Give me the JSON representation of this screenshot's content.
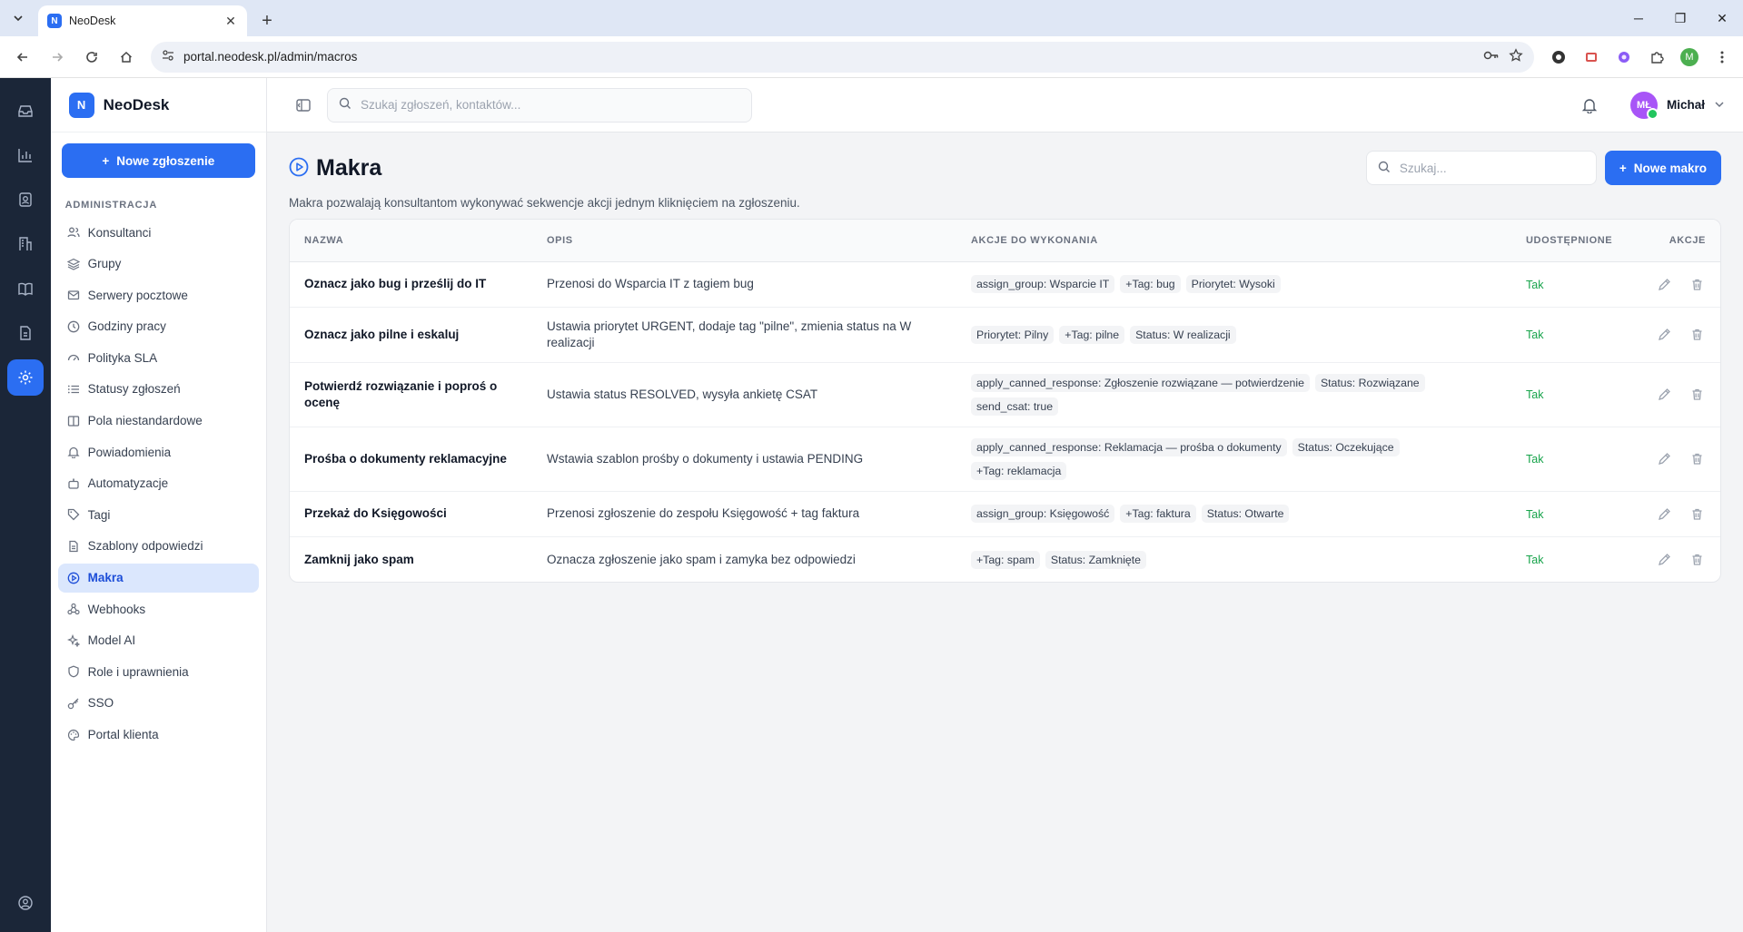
{
  "browser": {
    "tab_title": "NeoDesk",
    "favicon_letter": "N",
    "url": "portal.neodesk.pl/admin/macros",
    "profile_letter": "M"
  },
  "app": {
    "brand_letter": "N",
    "brand_name": "NeoDesk",
    "new_ticket_label": "Nowe zgłoszenie",
    "section_label": "ADMINISTRACJA",
    "nav": [
      {
        "label": "Konsultanci",
        "icon": "users-icon"
      },
      {
        "label": "Grupy",
        "icon": "layers-icon"
      },
      {
        "label": "Serwery pocztowe",
        "icon": "mail-icon"
      },
      {
        "label": "Godziny pracy",
        "icon": "clock-icon"
      },
      {
        "label": "Polityka SLA",
        "icon": "gauge-icon"
      },
      {
        "label": "Statusy zgłoszeń",
        "icon": "list-icon"
      },
      {
        "label": "Pola niestandardowe",
        "icon": "columns-icon"
      },
      {
        "label": "Powiadomienia",
        "icon": "bell-icon"
      },
      {
        "label": "Automatyzacje",
        "icon": "robot-icon"
      },
      {
        "label": "Tagi",
        "icon": "tag-icon"
      },
      {
        "label": "Szablony odpowiedzi",
        "icon": "document-icon"
      },
      {
        "label": "Makra",
        "icon": "play-circle-icon",
        "active": true
      },
      {
        "label": "Webhooks",
        "icon": "webhook-icon"
      },
      {
        "label": "Model AI",
        "icon": "sparkles-icon"
      },
      {
        "label": "Role i uprawnienia",
        "icon": "shield-icon"
      },
      {
        "label": "SSO",
        "icon": "key-icon"
      },
      {
        "label": "Portal klienta",
        "icon": "palette-icon"
      }
    ]
  },
  "topbar": {
    "search_placeholder": "Szukaj zgłoszeń, kontaktów...",
    "user_initials": "MŁ",
    "user_name": "Michał"
  },
  "page": {
    "title": "Makra",
    "description": "Makra pozwalają konsultantom wykonywać sekwencje akcji jednym kliknięciem na zgłoszeniu.",
    "search_placeholder": "Szukaj...",
    "new_button": "Nowe makro"
  },
  "table": {
    "headers": [
      "NAZWA",
      "OPIS",
      "AKCJE DO WYKONANIA",
      "UDOSTĘPNIONE",
      "AKCJE"
    ],
    "rows": [
      {
        "name": "Oznacz jako bug i prześlij do IT",
        "desc": "Przenosi do Wsparcia IT z tagiem bug",
        "actions": [
          "assign_group: Wsparcie IT",
          "+Tag: bug",
          "Priorytet: Wysoki"
        ],
        "shared": "Tak"
      },
      {
        "name": "Oznacz jako pilne i eskaluj",
        "desc": "Ustawia priorytet URGENT, dodaje tag \"pilne\", zmienia status na W realizacji",
        "actions": [
          "Priorytet: Pilny",
          "+Tag: pilne",
          "Status: W realizacji"
        ],
        "shared": "Tak"
      },
      {
        "name": "Potwierdź rozwiązanie i poproś o ocenę",
        "desc": "Ustawia status RESOLVED, wysyła ankietę CSAT",
        "actions": [
          "apply_canned_response: Zgłoszenie rozwiązane — potwierdzenie",
          "Status: Rozwiązane",
          "send_csat: true"
        ],
        "shared": "Tak"
      },
      {
        "name": "Prośba o dokumenty reklamacyjne",
        "desc": "Wstawia szablon prośby o dokumenty i ustawia PENDING",
        "actions": [
          "apply_canned_response: Reklamacja — prośba o dokumenty",
          "Status: Oczekujące",
          "+Tag: reklamacja"
        ],
        "shared": "Tak"
      },
      {
        "name": "Przekaż do Księgowości",
        "desc": "Przenosi zgłoszenie do zespołu Księgowość + tag faktura",
        "actions": [
          "assign_group: Księgowość",
          "+Tag: faktura",
          "Status: Otwarte"
        ],
        "shared": "Tak"
      },
      {
        "name": "Zamknij jako spam",
        "desc": "Oznacza zgłoszenie jako spam i zamyka bez odpowiedzi",
        "actions": [
          "+Tag: spam",
          "Status: Zamknięte"
        ],
        "shared": "Tak"
      }
    ]
  },
  "colors": {
    "accent": "#2b6ef2",
    "rail_bg": "#1b2638",
    "shared_green": "#16a34a",
    "avatar_bg": "#a855f7"
  }
}
